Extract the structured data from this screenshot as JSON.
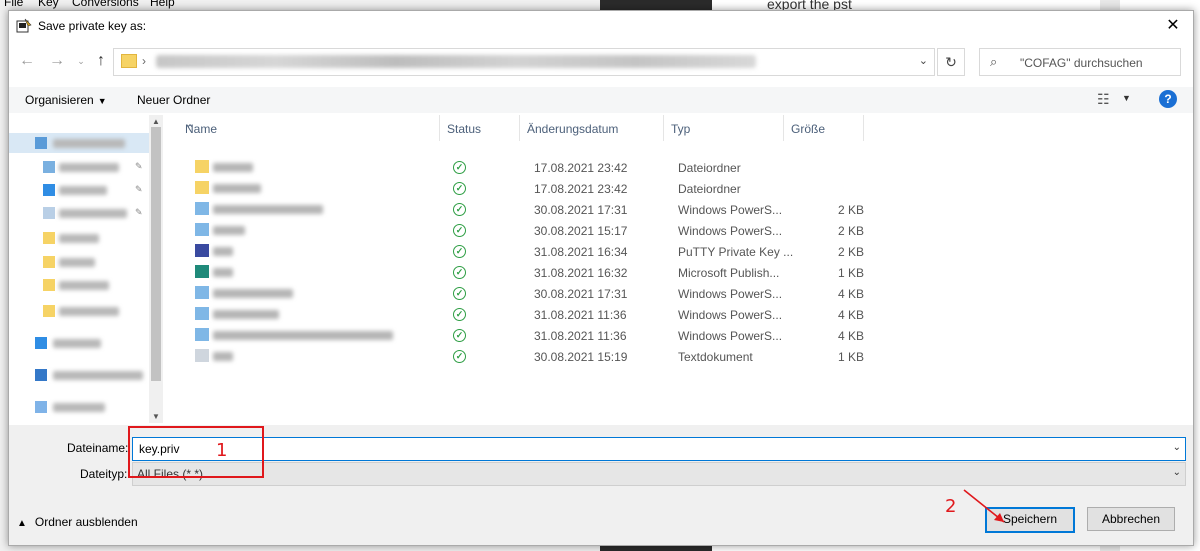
{
  "background": {
    "menu_items": [
      "File",
      "Key",
      "Conversions",
      "Help"
    ],
    "right_text": "export the pst"
  },
  "dialog": {
    "title": "Save private key as:",
    "close_icon": "close-icon"
  },
  "nav": {
    "back_icon": "back-arrow-icon",
    "forward_icon": "forward-arrow-icon",
    "recent_icon": "chevron-down-icon",
    "up_icon": "up-arrow-icon",
    "refresh_icon": "refresh-icon",
    "search_placeholder": "\"COFAG\" durchsuchen"
  },
  "toolbar": {
    "organize": "Organisieren",
    "new_folder": "Neuer Ordner",
    "help": "?"
  },
  "columns": {
    "name": "Name",
    "status": "Status",
    "modified": "Änderungsdatum",
    "type": "Typ",
    "size": "Größe"
  },
  "files": [
    {
      "date": "17.08.2021 23:42",
      "type": "Dateiordner",
      "size": "",
      "icon": "folder"
    },
    {
      "date": "17.08.2021 23:42",
      "type": "Dateiordner",
      "size": "",
      "icon": "folder"
    },
    {
      "date": "30.08.2021 17:31",
      "type": "Windows PowerS...",
      "size": "2 KB",
      "icon": "ps"
    },
    {
      "date": "30.08.2021 15:17",
      "type": "Windows PowerS...",
      "size": "2 KB",
      "icon": "ps"
    },
    {
      "date": "31.08.2021 16:34",
      "type": "PuTTY Private Key ...",
      "size": "2 KB",
      "icon": "putty"
    },
    {
      "date": "31.08.2021 16:32",
      "type": "Microsoft Publish...",
      "size": "1 KB",
      "icon": "pub"
    },
    {
      "date": "30.08.2021 17:31",
      "type": "Windows PowerS...",
      "size": "4 KB",
      "icon": "ps"
    },
    {
      "date": "31.08.2021 11:36",
      "type": "Windows PowerS...",
      "size": "4 KB",
      "icon": "ps"
    },
    {
      "date": "31.08.2021 11:36",
      "type": "Windows PowerS...",
      "size": "4 KB",
      "icon": "ps"
    },
    {
      "date": "30.08.2021 15:19",
      "type": "Textdokument",
      "size": "1 KB",
      "icon": "txt"
    }
  ],
  "form": {
    "filename_label": "Dateiname:",
    "filename_value": "key.priv",
    "filetype_label": "Dateityp:",
    "filetype_value": "All Files (*.*)"
  },
  "footer": {
    "hide_folders": "Ordner ausblenden",
    "save": "Speichern",
    "cancel": "Abbrechen"
  },
  "annotations": {
    "step1": "1",
    "step2": "2",
    "color": "#e0181c"
  }
}
